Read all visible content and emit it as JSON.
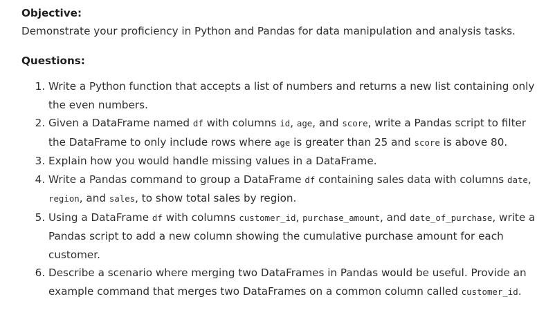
{
  "objective": {
    "heading": "Objective:",
    "text": "Demonstrate your proficiency in Python and Pandas for data manipulation and analysis tasks."
  },
  "questions": {
    "heading": "Questions:",
    "items": [
      {
        "parts": [
          {
            "t": "Write a Python function that accepts a list of numbers and returns a new list containing only the even numbers."
          }
        ]
      },
      {
        "parts": [
          {
            "t": "Given a DataFrame named "
          },
          {
            "c": "df"
          },
          {
            "t": " with columns "
          },
          {
            "c": "id"
          },
          {
            "t": ", "
          },
          {
            "c": "age"
          },
          {
            "t": ", and "
          },
          {
            "c": "score"
          },
          {
            "t": ", write a Pandas script to filter the DataFrame to only include rows where "
          },
          {
            "c": "age"
          },
          {
            "t": " is greater than 25 and "
          },
          {
            "c": "score"
          },
          {
            "t": " is above 80."
          }
        ]
      },
      {
        "parts": [
          {
            "t": "Explain how you would handle missing values in a DataFrame."
          }
        ]
      },
      {
        "parts": [
          {
            "t": "Write a Pandas command to group a DataFrame "
          },
          {
            "c": "df"
          },
          {
            "t": " containing sales data with columns "
          },
          {
            "c": "date"
          },
          {
            "t": ", "
          },
          {
            "c": "region"
          },
          {
            "t": ", and "
          },
          {
            "c": "sales"
          },
          {
            "t": ", to show total sales by region."
          }
        ]
      },
      {
        "parts": [
          {
            "t": "Using a DataFrame "
          },
          {
            "c": "df"
          },
          {
            "t": " with columns "
          },
          {
            "c": "customer_id"
          },
          {
            "t": ", "
          },
          {
            "c": "purchase_amount"
          },
          {
            "t": ", and "
          },
          {
            "c": "date_of_purchase"
          },
          {
            "t": ", write a Pandas script to add a new column showing the cumulative purchase amount for each customer."
          }
        ]
      },
      {
        "parts": [
          {
            "t": "Describe a scenario where merging two DataFrames in Pandas would be useful. Provide an example command that merges two DataFrames on a common column called "
          },
          {
            "c": "customer_id"
          },
          {
            "t": "."
          }
        ]
      }
    ]
  }
}
